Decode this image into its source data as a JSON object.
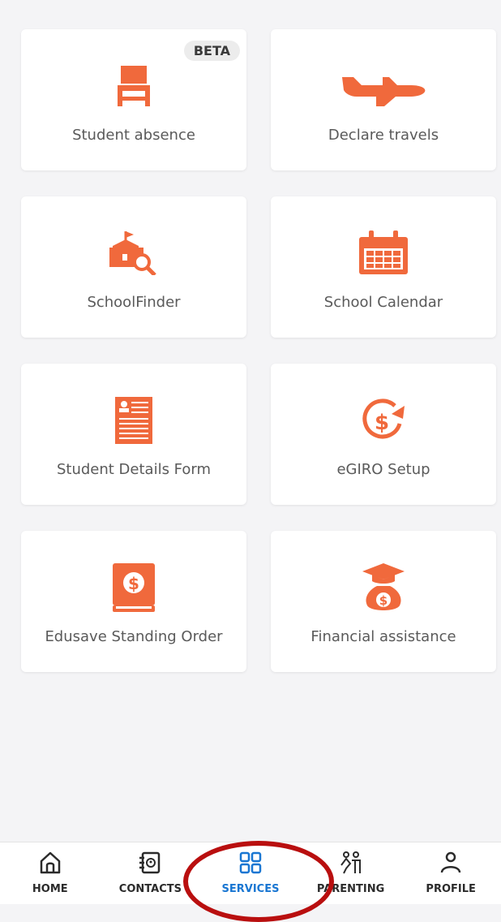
{
  "colors": {
    "accent": "#f0693c",
    "nav_active": "#1976d2"
  },
  "services": [
    {
      "label": "Student absence",
      "icon": "desk-chair-icon",
      "badge": "BETA"
    },
    {
      "label": "Declare travels",
      "icon": "airplane-icon"
    },
    {
      "label": "SchoolFinder",
      "icon": "school-search-icon"
    },
    {
      "label": "School Calendar",
      "icon": "calendar-icon"
    },
    {
      "label": "Student Details Form",
      "icon": "form-icon"
    },
    {
      "label": "eGIRO Setup",
      "icon": "dollar-refresh-icon"
    },
    {
      "label": "Edusave Standing Order",
      "icon": "dollar-book-icon"
    },
    {
      "label": "Financial assistance",
      "icon": "money-bag-graduation-icon"
    }
  ],
  "nav": {
    "items": [
      {
        "label": "HOME",
        "icon": "home-icon"
      },
      {
        "label": "CONTACTS",
        "icon": "contacts-book-icon"
      },
      {
        "label": "SERVICES",
        "icon": "grid-icon",
        "active": true
      },
      {
        "label": "PARENTING",
        "icon": "parenting-icon"
      },
      {
        "label": "PROFILE",
        "icon": "person-icon"
      }
    ]
  }
}
